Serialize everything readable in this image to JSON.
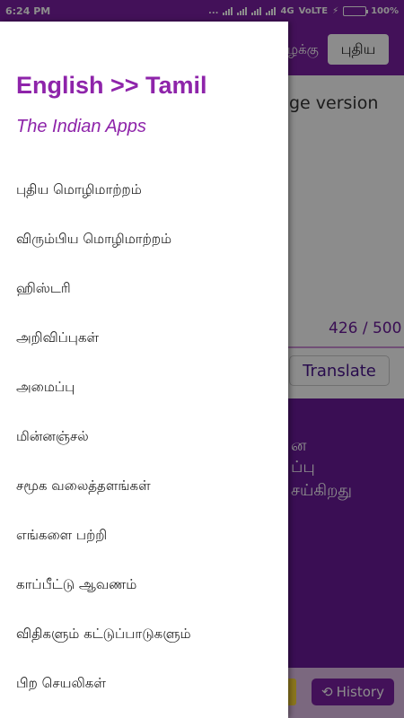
{
  "status": {
    "time": "6:24 PM",
    "dots": "...",
    "network": "4G",
    "volte": "VoLTE",
    "battery": "100%"
  },
  "app": {
    "header_text": "ழக்கு",
    "header_button": "புதிய",
    "input_text": "ge version",
    "counter": "426 / 500",
    "translate_button": "Translate",
    "output_lines": [
      "ன",
      "ப்பு",
      "சய்கிறது"
    ],
    "history_button": "History"
  },
  "drawer": {
    "title": "English >> Tamil",
    "subtitle": "The Indian Apps",
    "items": [
      "புதிய மொழிமாற்றம்",
      "விரும்பிய மொழிமாற்றம்",
      "ஹிஸ்டரி",
      "அறிவிப்புகள்",
      "அமைப்பு",
      "மின்னஞ்சல்",
      "சமூக வலைத்தளங்கள்",
      "எங்களை பற்றி",
      "காப்பீட்டு ஆவணம்",
      "விதிகளும் கட்டுப்பாடுகளும்",
      "பிற செயலிகள்"
    ]
  },
  "colors": {
    "primary": "#7b1fa2",
    "accent_text": "#8e24aa",
    "battery": "#4caf50"
  }
}
